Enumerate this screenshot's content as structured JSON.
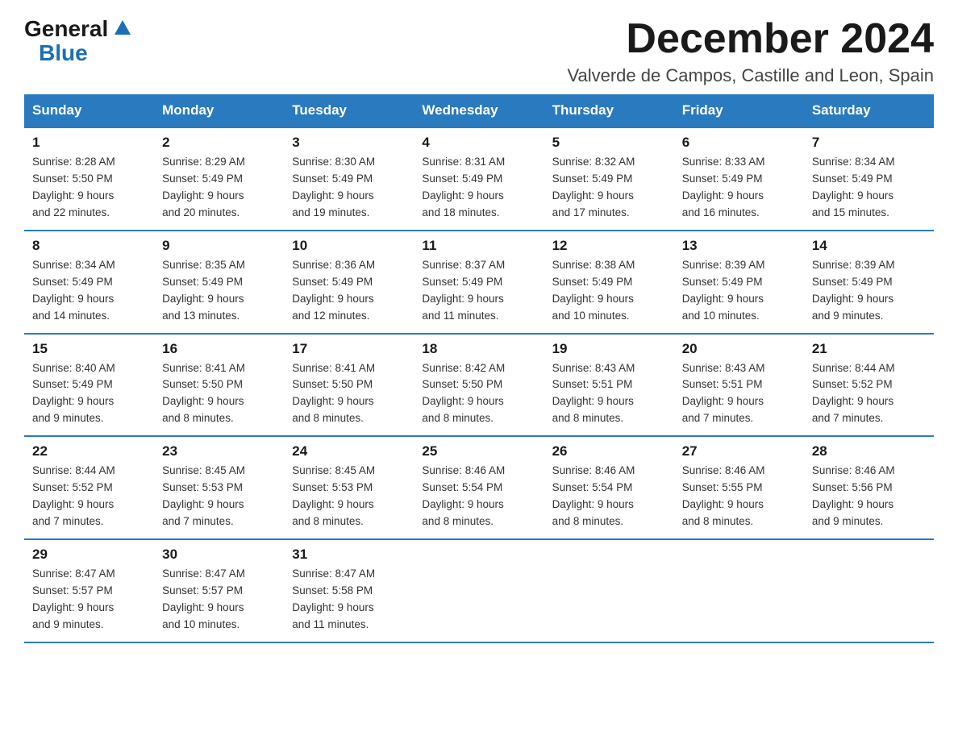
{
  "header": {
    "logo_general": "General",
    "logo_blue": "Blue",
    "month_title": "December 2024",
    "location": "Valverde de Campos, Castille and Leon, Spain"
  },
  "calendar": {
    "days_of_week": [
      "Sunday",
      "Monday",
      "Tuesday",
      "Wednesday",
      "Thursday",
      "Friday",
      "Saturday"
    ],
    "weeks": [
      [
        {
          "day": "1",
          "sunrise": "8:28 AM",
          "sunset": "5:50 PM",
          "daylight": "9 hours and 22 minutes."
        },
        {
          "day": "2",
          "sunrise": "8:29 AM",
          "sunset": "5:49 PM",
          "daylight": "9 hours and 20 minutes."
        },
        {
          "day": "3",
          "sunrise": "8:30 AM",
          "sunset": "5:49 PM",
          "daylight": "9 hours and 19 minutes."
        },
        {
          "day": "4",
          "sunrise": "8:31 AM",
          "sunset": "5:49 PM",
          "daylight": "9 hours and 18 minutes."
        },
        {
          "day": "5",
          "sunrise": "8:32 AM",
          "sunset": "5:49 PM",
          "daylight": "9 hours and 17 minutes."
        },
        {
          "day": "6",
          "sunrise": "8:33 AM",
          "sunset": "5:49 PM",
          "daylight": "9 hours and 16 minutes."
        },
        {
          "day": "7",
          "sunrise": "8:34 AM",
          "sunset": "5:49 PM",
          "daylight": "9 hours and 15 minutes."
        }
      ],
      [
        {
          "day": "8",
          "sunrise": "8:34 AM",
          "sunset": "5:49 PM",
          "daylight": "9 hours and 14 minutes."
        },
        {
          "day": "9",
          "sunrise": "8:35 AM",
          "sunset": "5:49 PM",
          "daylight": "9 hours and 13 minutes."
        },
        {
          "day": "10",
          "sunrise": "8:36 AM",
          "sunset": "5:49 PM",
          "daylight": "9 hours and 12 minutes."
        },
        {
          "day": "11",
          "sunrise": "8:37 AM",
          "sunset": "5:49 PM",
          "daylight": "9 hours and 11 minutes."
        },
        {
          "day": "12",
          "sunrise": "8:38 AM",
          "sunset": "5:49 PM",
          "daylight": "9 hours and 10 minutes."
        },
        {
          "day": "13",
          "sunrise": "8:39 AM",
          "sunset": "5:49 PM",
          "daylight": "9 hours and 10 minutes."
        },
        {
          "day": "14",
          "sunrise": "8:39 AM",
          "sunset": "5:49 PM",
          "daylight": "9 hours and 9 minutes."
        }
      ],
      [
        {
          "day": "15",
          "sunrise": "8:40 AM",
          "sunset": "5:49 PM",
          "daylight": "9 hours and 9 minutes."
        },
        {
          "day": "16",
          "sunrise": "8:41 AM",
          "sunset": "5:50 PM",
          "daylight": "9 hours and 8 minutes."
        },
        {
          "day": "17",
          "sunrise": "8:41 AM",
          "sunset": "5:50 PM",
          "daylight": "9 hours and 8 minutes."
        },
        {
          "day": "18",
          "sunrise": "8:42 AM",
          "sunset": "5:50 PM",
          "daylight": "9 hours and 8 minutes."
        },
        {
          "day": "19",
          "sunrise": "8:43 AM",
          "sunset": "5:51 PM",
          "daylight": "9 hours and 8 minutes."
        },
        {
          "day": "20",
          "sunrise": "8:43 AM",
          "sunset": "5:51 PM",
          "daylight": "9 hours and 7 minutes."
        },
        {
          "day": "21",
          "sunrise": "8:44 AM",
          "sunset": "5:52 PM",
          "daylight": "9 hours and 7 minutes."
        }
      ],
      [
        {
          "day": "22",
          "sunrise": "8:44 AM",
          "sunset": "5:52 PM",
          "daylight": "9 hours and 7 minutes."
        },
        {
          "day": "23",
          "sunrise": "8:45 AM",
          "sunset": "5:53 PM",
          "daylight": "9 hours and 7 minutes."
        },
        {
          "day": "24",
          "sunrise": "8:45 AM",
          "sunset": "5:53 PM",
          "daylight": "9 hours and 8 minutes."
        },
        {
          "day": "25",
          "sunrise": "8:46 AM",
          "sunset": "5:54 PM",
          "daylight": "9 hours and 8 minutes."
        },
        {
          "day": "26",
          "sunrise": "8:46 AM",
          "sunset": "5:54 PM",
          "daylight": "9 hours and 8 minutes."
        },
        {
          "day": "27",
          "sunrise": "8:46 AM",
          "sunset": "5:55 PM",
          "daylight": "9 hours and 8 minutes."
        },
        {
          "day": "28",
          "sunrise": "8:46 AM",
          "sunset": "5:56 PM",
          "daylight": "9 hours and 9 minutes."
        }
      ],
      [
        {
          "day": "29",
          "sunrise": "8:47 AM",
          "sunset": "5:57 PM",
          "daylight": "9 hours and 9 minutes."
        },
        {
          "day": "30",
          "sunrise": "8:47 AM",
          "sunset": "5:57 PM",
          "daylight": "9 hours and 10 minutes."
        },
        {
          "day": "31",
          "sunrise": "8:47 AM",
          "sunset": "5:58 PM",
          "daylight": "9 hours and 11 minutes."
        },
        null,
        null,
        null,
        null
      ]
    ]
  },
  "labels": {
    "sunrise_prefix": "Sunrise: ",
    "sunset_prefix": "Sunset: ",
    "daylight_prefix": "Daylight: "
  }
}
